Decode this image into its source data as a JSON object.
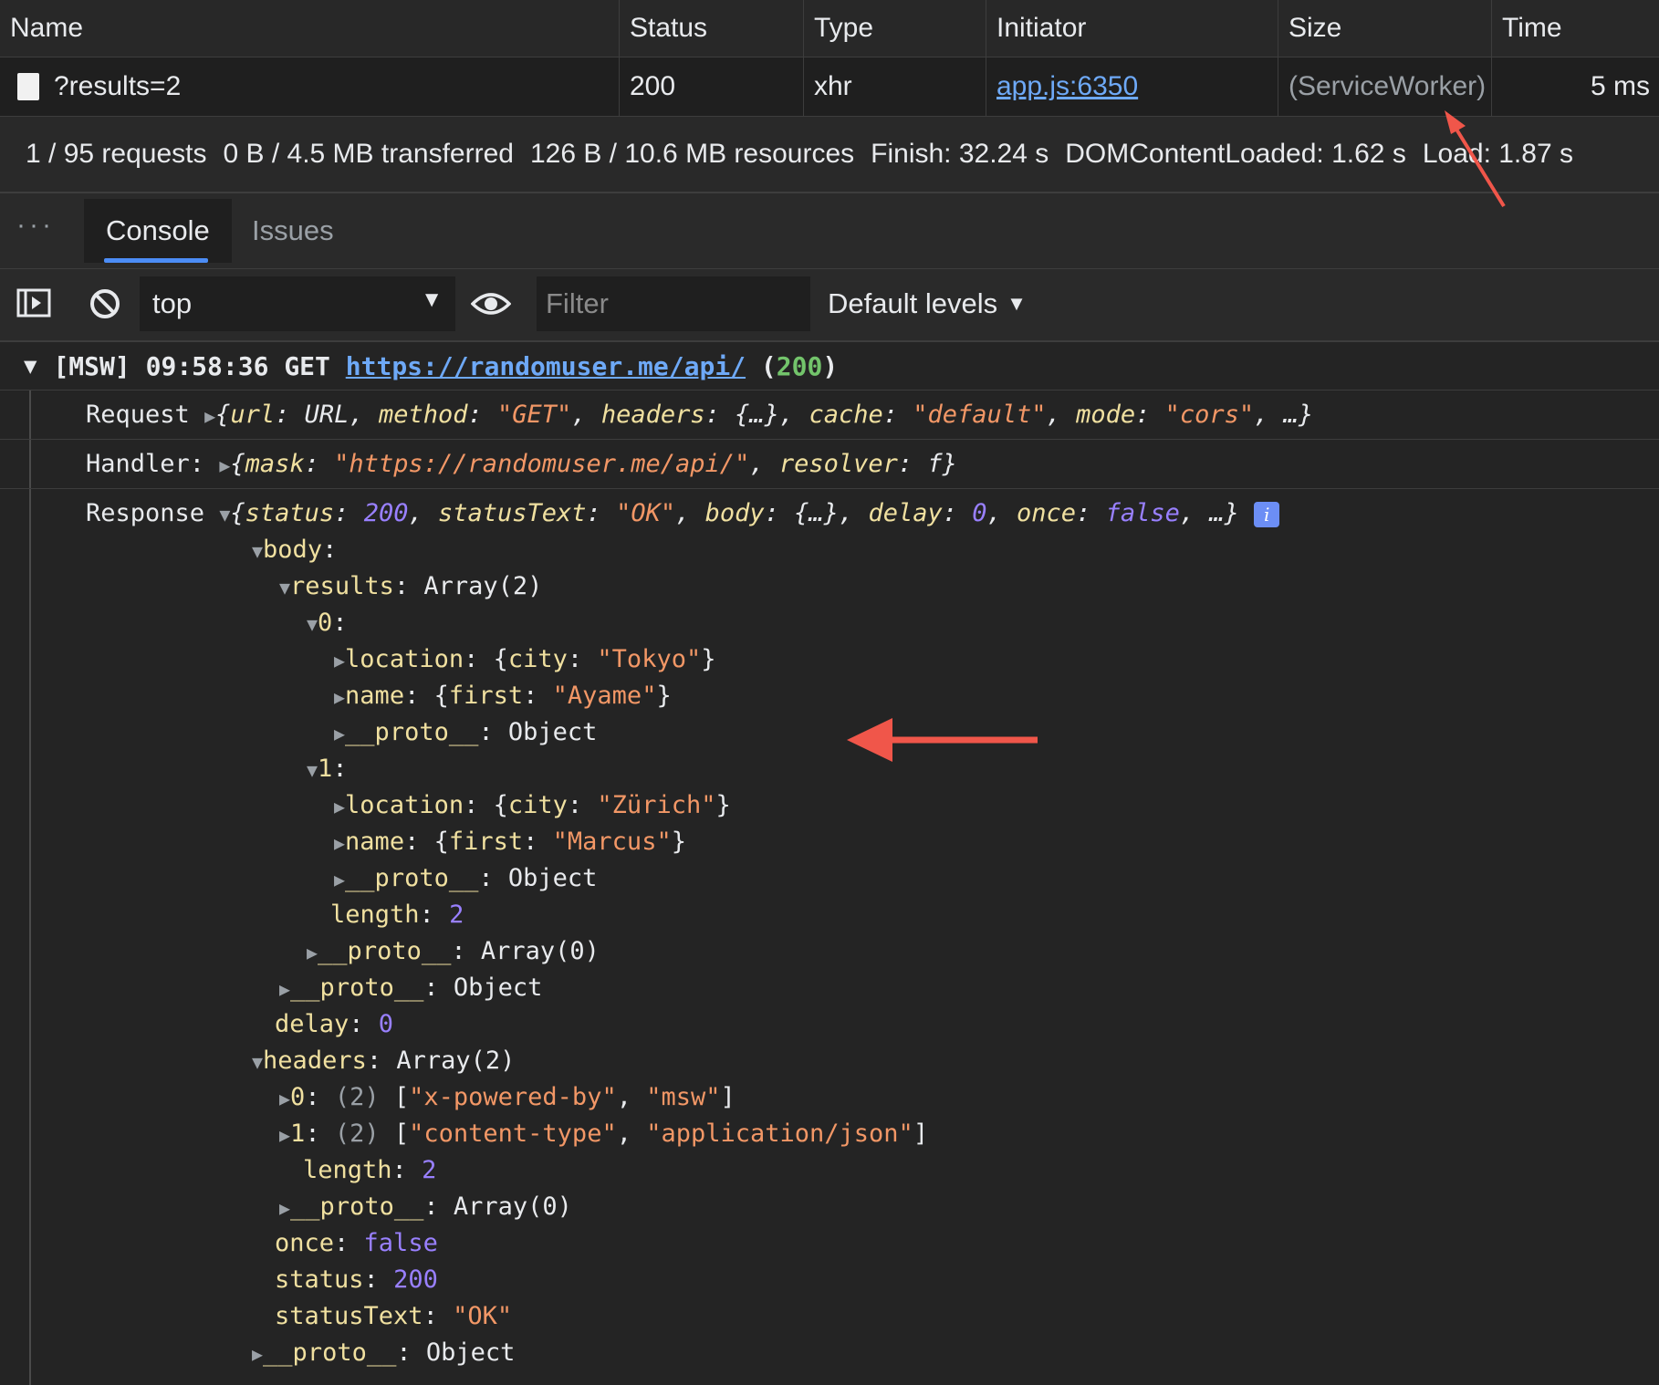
{
  "network": {
    "columns": [
      "Name",
      "Status",
      "Type",
      "Initiator",
      "Size",
      "Time"
    ],
    "row": {
      "name": "?results=2",
      "status": "200",
      "type": "xhr",
      "initiator": "app.js:6350",
      "size": "(ServiceWorker)",
      "time": "5 ms"
    },
    "summary": {
      "requests": "1 / 95 requests",
      "transferred": "0 B / 4.5 MB transferred",
      "resources": "126 B / 10.6 MB resources",
      "finish": "Finish: 32.24 s",
      "dcl": "DOMContentLoaded: 1.62 s",
      "load": "Load: 1.87 s"
    }
  },
  "drawer": {
    "more": "···",
    "tabs": [
      "Console",
      "Issues"
    ]
  },
  "console_toolbar": {
    "context": "top",
    "filter_placeholder": "Filter",
    "levels": "Default levels"
  },
  "console": {
    "head": {
      "prefix": "[MSW] 09:58:36 GET ",
      "url": "https://randomuser.me/api/",
      "open": " (",
      "code": "200",
      "close": ")"
    },
    "request": {
      "label": "Request",
      "p1k": "url",
      "p1v": "URL",
      "p2k": "method",
      "p2v": "\"GET\"",
      "p3k": "headers",
      "p3v": "{…}",
      "p4k": "cache",
      "p4v": "\"default\"",
      "p5k": "mode",
      "p5v": "\"cors\"",
      "tail": ", …}"
    },
    "handler": {
      "label": "Handler:",
      "p1k": "mask",
      "p1v": "\"https://randomuser.me/api/\"",
      "p2k": "resolver",
      "p2v": "f"
    },
    "response": {
      "label": "Response",
      "p1k": "status",
      "p1v": "200",
      "p2k": "statusText",
      "p2v": "\"OK\"",
      "p3k": "body",
      "p3v": "{…}",
      "p4k": "delay",
      "p4v": "0",
      "p5k": "once",
      "p5v": "false",
      "tail": ", …}",
      "badge": "i"
    },
    "tree": {
      "body": "body",
      "results": "results",
      "results_val": "Array(2)",
      "idx0": "0",
      "idx1": "1",
      "location": "location",
      "city_key": "city",
      "city0": "\"Tokyo\"",
      "city1": "\"Zürich\"",
      "name": "name",
      "first_key": "first",
      "first0": "\"Ayame\"",
      "first1": "\"Marcus\"",
      "proto": "__proto__",
      "object": "Object",
      "array0": "Array(0)",
      "length": "length",
      "length_val": "2",
      "delay": "delay",
      "delay_val": "0",
      "headers": "headers",
      "headers_val": "Array(2)",
      "h0_count": "(2)",
      "h0_a": "\"x-powered-by\"",
      "h0_b": "\"msw\"",
      "h1_count": "(2)",
      "h1_a": "\"content-type\"",
      "h1_b": "\"application/json\"",
      "once": "once",
      "once_val": "false",
      "status": "status",
      "status_val": "200",
      "statusText": "statusText",
      "statusText_val": "\"OK\""
    }
  },
  "colors": {
    "annotation_arrow": "#f0564a",
    "link": "#6ea9f7",
    "string": "#f29766",
    "number": "#9980ff",
    "key": "#f0e0a0"
  }
}
